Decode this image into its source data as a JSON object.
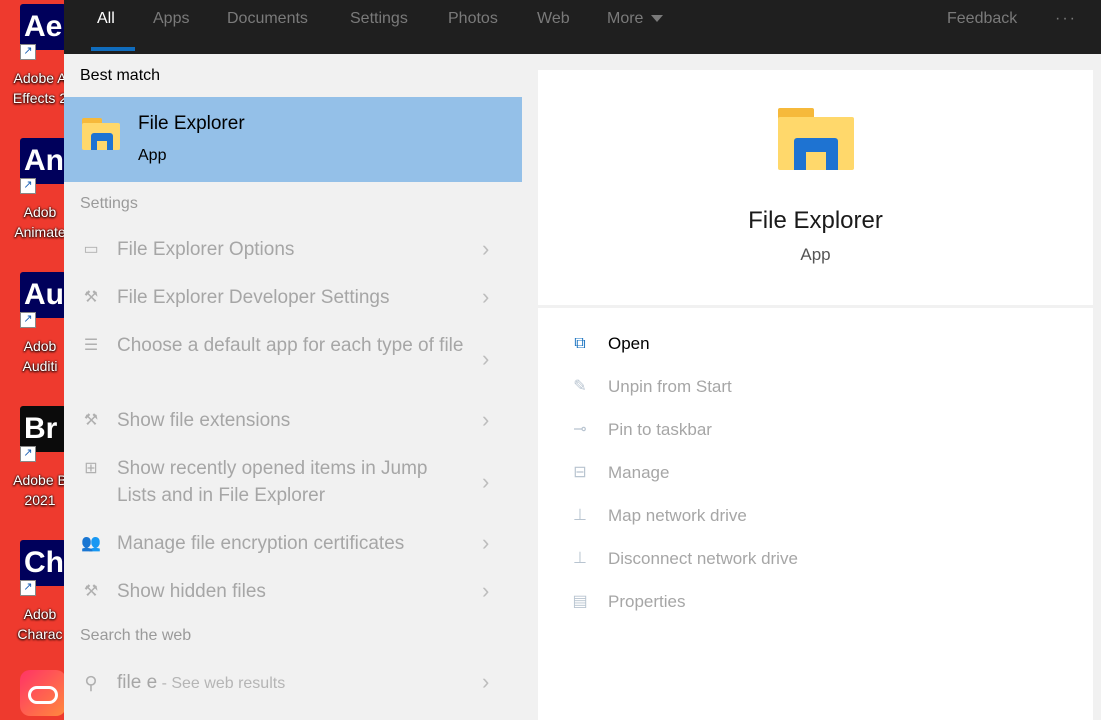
{
  "desktop": {
    "icons": [
      {
        "tile": "Ae",
        "label1": "Adobe A",
        "label2": "Effects 2"
      },
      {
        "tile": "An",
        "label1": "Adob",
        "label2": "Animate"
      },
      {
        "tile": "Au",
        "label1": "Adob",
        "label2": "Auditi"
      },
      {
        "tile": "Br",
        "label1": "Adobe B",
        "label2": "2021"
      },
      {
        "tile": "Ch",
        "label1": "Adob",
        "label2": "Charac"
      }
    ],
    "shortcut_arrow": "↗"
  },
  "topbar": {
    "tabs": [
      "All",
      "Apps",
      "Documents",
      "Settings",
      "Photos",
      "Web",
      "More"
    ],
    "active_tab": "All",
    "feedback": "Feedback",
    "overflow": "···"
  },
  "left": {
    "best_match_heading": "Best match",
    "best_match": {
      "name": "File Explorer",
      "type": "App"
    },
    "settings_heading": "Settings",
    "settings_items": [
      {
        "label": "File Explorer Options",
        "icon": "options-icon"
      },
      {
        "label": "File Explorer Developer Settings",
        "icon": "tools-icon"
      },
      {
        "label": "Choose a default app for each type of file",
        "icon": "list-icon"
      },
      {
        "label": "Show file extensions",
        "icon": "tools-icon"
      },
      {
        "label": "Show recently opened items in Jump Lists and in File Explorer",
        "icon": "grid-icon"
      },
      {
        "label": "Manage file encryption certificates",
        "icon": "users-icon"
      },
      {
        "label": "Show hidden files",
        "icon": "tools-icon"
      }
    ],
    "web_heading": "Search the web",
    "web_query": "file e",
    "web_suffix": " - See web results"
  },
  "right": {
    "app_name": "File Explorer",
    "app_type": "App",
    "actions": [
      {
        "label": "Open",
        "icon": "open-window-icon",
        "enabled": true
      },
      {
        "label": "Unpin from Start",
        "icon": "unpin-icon",
        "enabled": false
      },
      {
        "label": "Pin to taskbar",
        "icon": "pin-icon",
        "enabled": false
      },
      {
        "label": "Manage",
        "icon": "manage-icon",
        "enabled": false
      },
      {
        "label": "Map network drive",
        "icon": "network-drive-icon",
        "enabled": false
      },
      {
        "label": "Disconnect network drive",
        "icon": "network-drive-icon",
        "enabled": false
      },
      {
        "label": "Properties",
        "icon": "properties-icon",
        "enabled": false
      }
    ]
  },
  "colors": {
    "accent": "#0f6cbd",
    "selection": "#94c0e8",
    "topbar": "#1f1f1f",
    "desktop": "#ee3a2e"
  }
}
